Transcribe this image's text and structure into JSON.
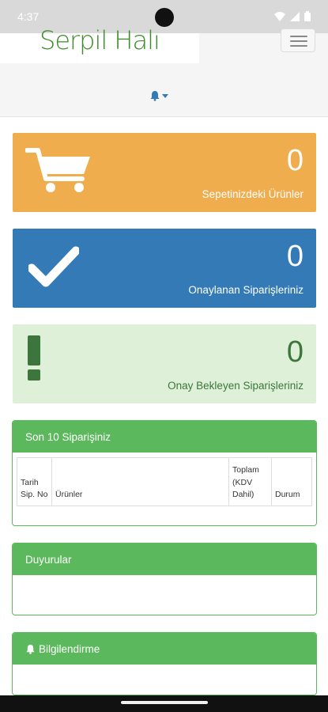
{
  "status_bar": {
    "time": "4:37"
  },
  "header": {
    "logo_text": "Serpil Halı"
  },
  "stats": [
    {
      "count": "0",
      "label": "Sepetinizdeki Ürünler",
      "color": "#f0ad4e",
      "icon": "cart-icon"
    },
    {
      "count": "0",
      "label": "Onaylanan Siparişleriniz",
      "color": "#337ab7",
      "icon": "check-icon"
    },
    {
      "count": "0",
      "label": "Onay Bekleyen Siparişleriniz",
      "color": "#dff0d8",
      "icon": "exclamation-icon"
    }
  ],
  "orders_panel": {
    "title": "Son 10 Siparişiniz",
    "columns": [
      "Tarih Sip. No",
      "Ürünler",
      "Toplam (KDV Dahil)",
      "Durum"
    ]
  },
  "announcements_panel": {
    "title": "Duyurular"
  },
  "info_panel": {
    "title": "Bilgilendirme"
  },
  "colors": {
    "panel_green": "#5cb85c",
    "logo_green": "#3c8d2a"
  }
}
